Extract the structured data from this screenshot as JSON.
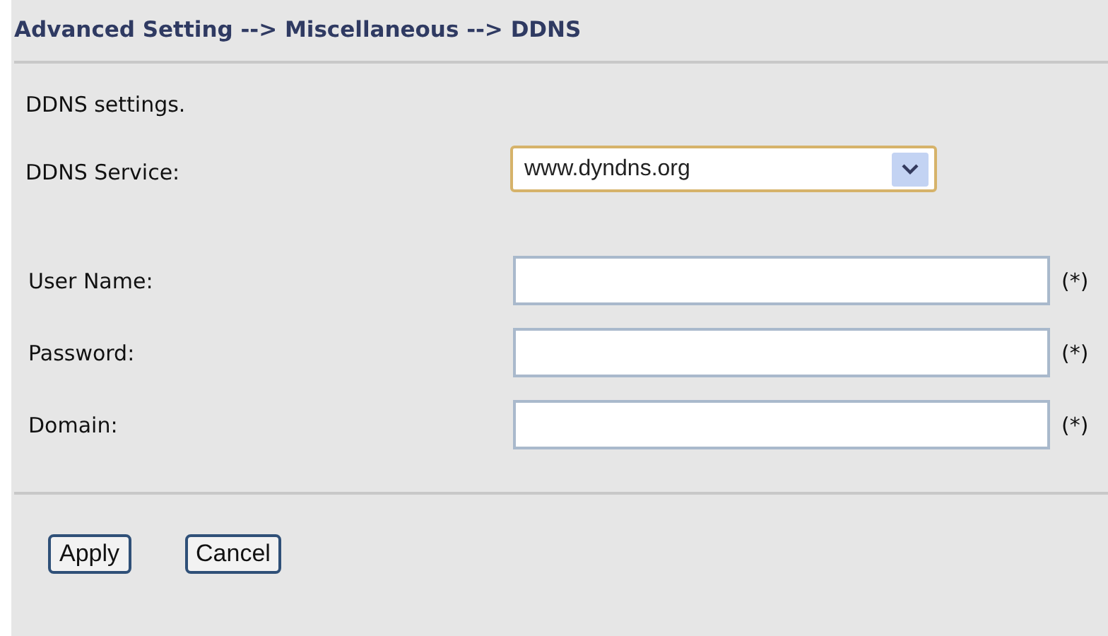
{
  "breadcrumb": "Advanced Setting --> Miscellaneous --> DDNS",
  "description": "DDNS settings.",
  "service": {
    "label": "DDNS Service:",
    "value": "www.dyndns.org"
  },
  "fields": [
    {
      "label": "User Name:",
      "required_mark": "(*)"
    },
    {
      "label": "Password:",
      "required_mark": "(*)"
    },
    {
      "label": "Domain:",
      "required_mark": "(*)"
    }
  ],
  "buttons": [
    "Apply",
    "Cancel"
  ]
}
